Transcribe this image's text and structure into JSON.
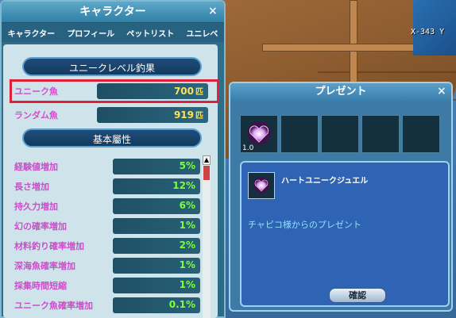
{
  "world": {
    "coord": "X-343 Y"
  },
  "char_panel": {
    "title": "キャラクター",
    "close": "×",
    "tabs": [
      "キャラクター",
      "プロフィール",
      "ペットリスト",
      "ユニレベ"
    ],
    "section1": "ユニークレベル釣果",
    "fish_rows": [
      {
        "label": "ユニーク魚",
        "value": "700",
        "unit": "匹"
      },
      {
        "label": "ランダム魚",
        "value": "919",
        "unit": "匹"
      }
    ],
    "section2": "基本屬性",
    "stats": [
      {
        "label": "経験値増加",
        "value": "5%"
      },
      {
        "label": "長さ増加",
        "value": "12%"
      },
      {
        "label": "持久力増加",
        "value": "6%"
      },
      {
        "label": "幻の確率増加",
        "value": "1%"
      },
      {
        "label": "材料釣り確率増加",
        "value": "2%"
      },
      {
        "label": "深海魚確率増加",
        "value": "1%"
      },
      {
        "label": "採集時間短縮",
        "value": "1%"
      },
      {
        "label": "ユニーク魚確率増加",
        "value": "0.1%"
      }
    ]
  },
  "present": {
    "title": "プレゼント",
    "close": "×",
    "slot_qty": "1.0",
    "item_name": "ハートユニークジュエル",
    "message": "チャピコ様からのプレゼント",
    "confirm": "確認"
  },
  "colors": {
    "stat_value": "#7dff3a",
    "fish_value": "#ffe15a",
    "label": "#c850c8",
    "highlight": "#e0203a"
  }
}
